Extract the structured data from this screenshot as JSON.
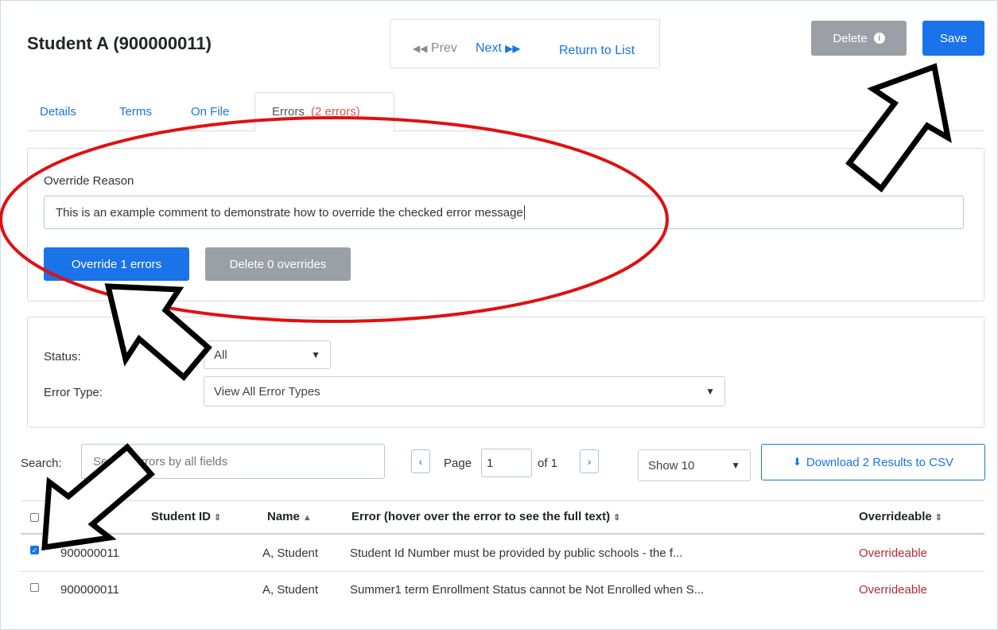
{
  "header": {
    "title": "Student A (900000011)",
    "prev_label": "Prev",
    "next_label": "Next",
    "return_label": "Return to List",
    "delete_label": "Delete",
    "save_label": "Save"
  },
  "tabs": [
    {
      "label": "Details"
    },
    {
      "label": "Terms"
    },
    {
      "label": "On File"
    },
    {
      "label": "Errors",
      "badge": "(2 errors)"
    }
  ],
  "override": {
    "label": "Override Reason",
    "value": "This is an example comment to demonstrate how to override the checked error message",
    "override_btn": "Override 1 errors",
    "delete_btn": "Delete 0 overrides"
  },
  "filters": {
    "status_label": "Status:",
    "status_value": "All",
    "type_label": "Error Type:",
    "type_value": "View All Error Types"
  },
  "toolbar": {
    "search_label": "Search:",
    "search_placeholder": "Search errors by all fields",
    "page_label": "Page",
    "page_value": "1",
    "of_label": "of 1",
    "show_value": "Show 10",
    "download_label": "Download 2 Results to CSV"
  },
  "table": {
    "columns": [
      "Student ID",
      "Name",
      "Error (hover over the error to see the full text)",
      "Overrideable"
    ],
    "rows": [
      {
        "checked": true,
        "id": "900000011",
        "name": "A, Student",
        "error": "Student Id Number must be provided by public schools - the f...",
        "status": "Overrideable"
      },
      {
        "checked": false,
        "id": "900000011",
        "name": "A, Student",
        "error": "Summer1 term Enrollment Status cannot be Not Enrolled when S...",
        "status": "Overrideable"
      }
    ]
  },
  "colors": {
    "primary": "#1a73e8",
    "secondary": "#9aa0a6",
    "danger_text": "#b02a37",
    "annotation": "#e01010"
  }
}
